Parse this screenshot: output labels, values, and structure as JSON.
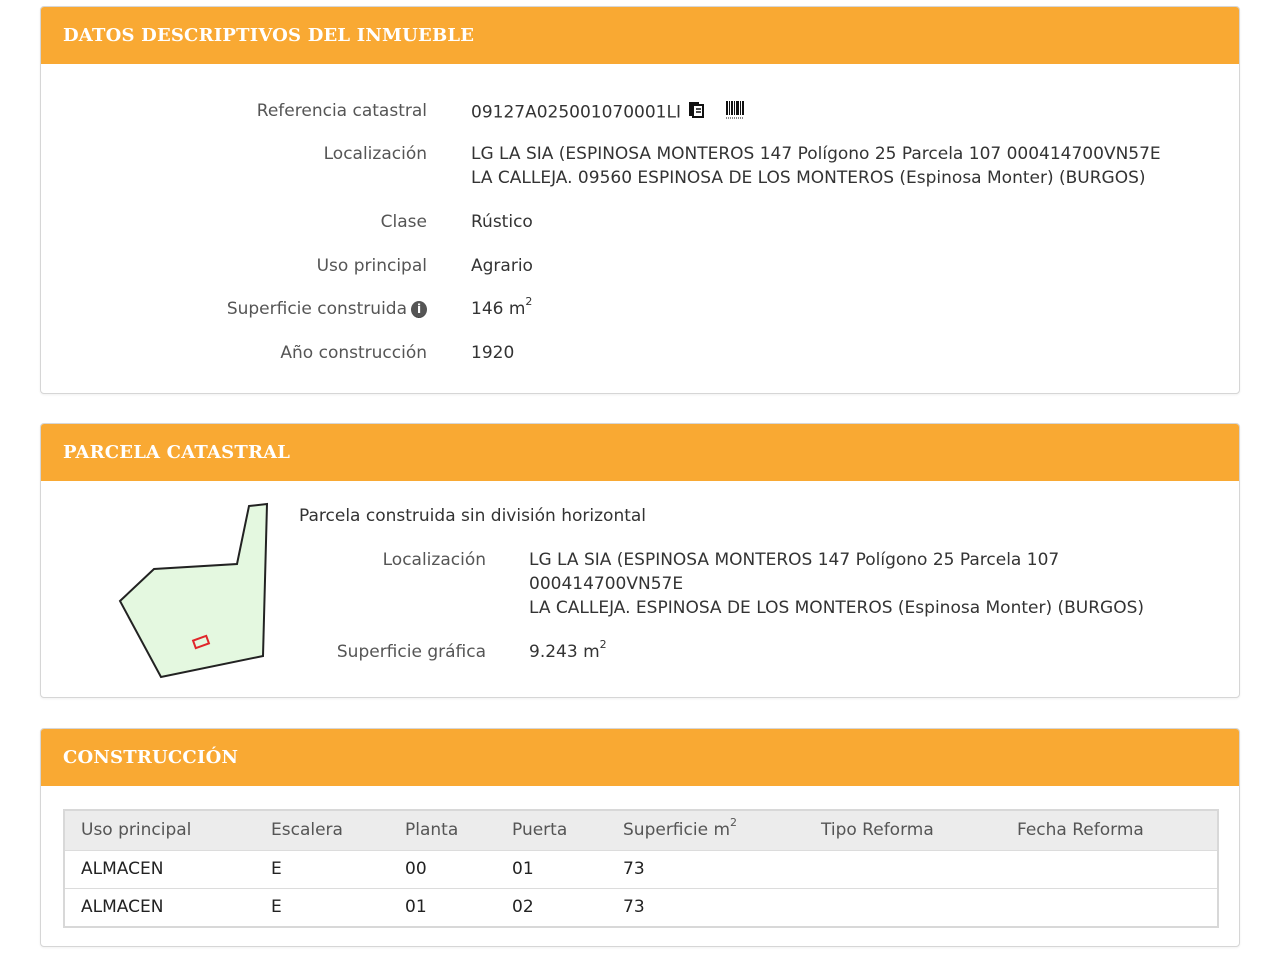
{
  "datos": {
    "header": "DATOS DESCRIPTIVOS DEL INMUEBLE",
    "rows": [
      {
        "label": "Referencia catastral",
        "value": "09127A025001070001LI"
      },
      {
        "label": "Localización",
        "value_line1": "LG LA SIA (ESPINOSA MONTEROS 147 Polígono 25 Parcela 107 000414700VN57E",
        "value_line2": "LA CALLEJA. 09560 ESPINOSA DE LOS MONTEROS (Espinosa Monter) (BURGOS)"
      },
      {
        "label": "Clase",
        "value": "Rústico"
      },
      {
        "label": "Uso principal",
        "value": "Agrario"
      },
      {
        "label": "Superficie construida",
        "value": "146 m",
        "unit_sup": "2"
      },
      {
        "label": "Año construcción",
        "value": "1920"
      }
    ],
    "icons": {
      "copy": "copy-document-icon",
      "barcode": "barcode-icon",
      "info": "info-icon"
    }
  },
  "parcela": {
    "header": "PARCELA CATASTRAL",
    "subtitle": "Parcela construida sin división horizontal",
    "loc_label": "Localización",
    "loc_line1": "LG LA SIA (ESPINOSA MONTEROS 147 Polígono 25 Parcela 107",
    "loc_line2": "000414700VN57E",
    "loc_line3": "LA CALLEJA. ESPINOSA DE LOS MONTEROS (Espinosa Monter) (BURGOS)",
    "sup_label": "Superficie gráfica",
    "sup_value": "9.243 m",
    "sup_unit_sup": "2",
    "colors": {
      "parcel_fill": "#e4f8e0",
      "parcel_stroke": "#222222",
      "building_stroke": "#e0262a"
    }
  },
  "construccion": {
    "header": "CONSTRUCCIÓN",
    "columns": [
      "Uso principal",
      "Escalera",
      "Planta",
      "Puerta",
      "Superficie m",
      "Tipo Reforma",
      "Fecha Reforma"
    ],
    "superficie_sup": "2",
    "rows": [
      [
        "ALMACEN",
        "E",
        "00",
        "01",
        "73",
        "",
        ""
      ],
      [
        "ALMACEN",
        "E",
        "01",
        "02",
        "73",
        "",
        ""
      ]
    ]
  },
  "colors": {
    "accent": "#f9a933",
    "table_header_bg": "#ececec"
  }
}
